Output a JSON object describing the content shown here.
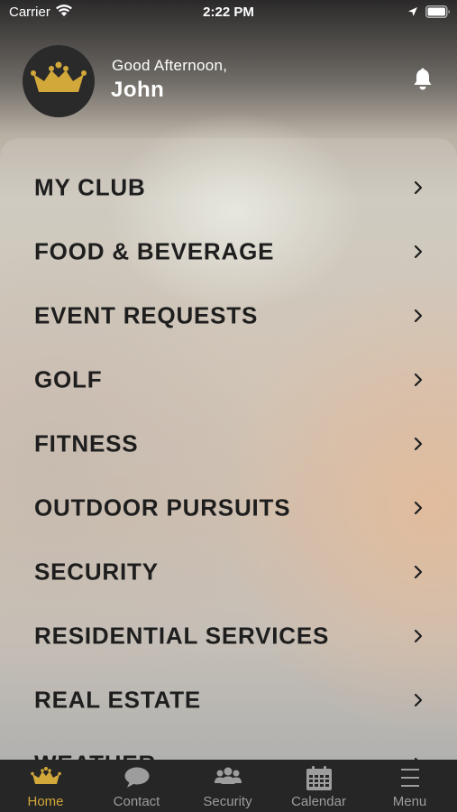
{
  "status_bar": {
    "carrier": "Carrier",
    "time": "2:22 PM"
  },
  "header": {
    "greeting": "Good Afternoon,",
    "user_name": "John"
  },
  "menu": {
    "items": [
      {
        "label": "MY CLUB"
      },
      {
        "label": "FOOD & BEVERAGE"
      },
      {
        "label": "EVENT REQUESTS"
      },
      {
        "label": "GOLF"
      },
      {
        "label": "FITNESS"
      },
      {
        "label": "OUTDOOR PURSUITS"
      },
      {
        "label": "SECURITY"
      },
      {
        "label": "RESIDENTIAL SERVICES"
      },
      {
        "label": "REAL ESTATE"
      },
      {
        "label": "WEATHER"
      }
    ]
  },
  "tab_bar": {
    "tabs": [
      {
        "label": "Home",
        "icon": "crown-icon",
        "active": true
      },
      {
        "label": "Contact",
        "icon": "chat-bubble-icon",
        "active": false
      },
      {
        "label": "Security",
        "icon": "people-group-icon",
        "active": false
      },
      {
        "label": "Calendar",
        "icon": "calendar-icon",
        "active": false
      },
      {
        "label": "Menu",
        "icon": "hamburger-menu-icon",
        "active": false
      }
    ]
  },
  "colors": {
    "accent_gold": "#d2a83a",
    "tab_bar_bg": "#262626",
    "menu_text": "#1e1e1e",
    "avatar_bg": "#2a2a2a"
  }
}
